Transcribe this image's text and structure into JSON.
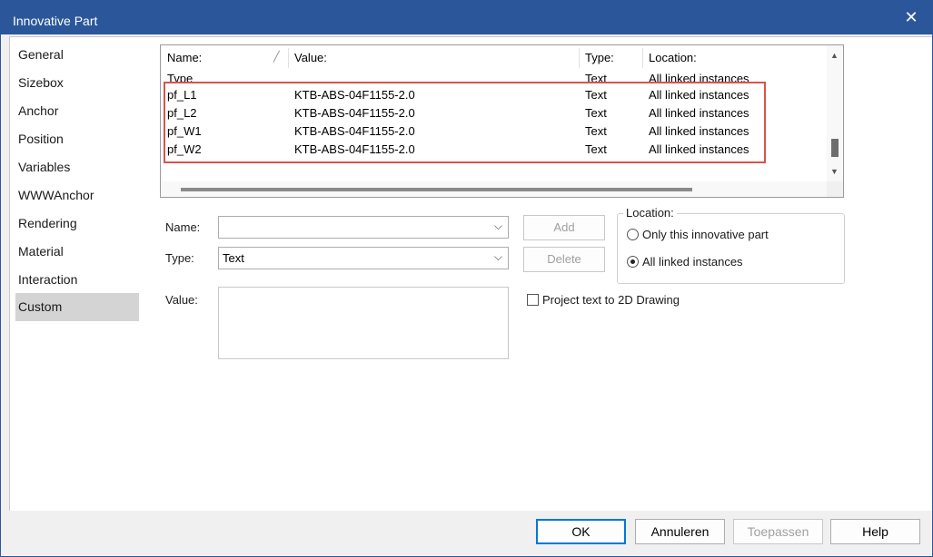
{
  "window": {
    "title": "Innovative Part"
  },
  "sidebar": {
    "items": [
      {
        "label": "General"
      },
      {
        "label": "Sizebox"
      },
      {
        "label": "Anchor"
      },
      {
        "label": "Position"
      },
      {
        "label": "Variables"
      },
      {
        "label": "WWWAnchor"
      },
      {
        "label": "Rendering"
      },
      {
        "label": "Material"
      },
      {
        "label": "Interaction"
      },
      {
        "label": "Custom",
        "selected": true
      }
    ]
  },
  "list": {
    "columns": [
      "Name:",
      "Value:",
      "Type:",
      "Location:"
    ],
    "rows": [
      {
        "name": "Type",
        "value": "",
        "type": "Text",
        "location": "All linked instances"
      },
      {
        "name": "pf_L1",
        "value": "KTB-ABS-04F1155-2.0",
        "type": "Text",
        "location": "All linked instances"
      },
      {
        "name": "pf_L2",
        "value": "KTB-ABS-04F1155-2.0",
        "type": "Text",
        "location": "All linked instances"
      },
      {
        "name": "pf_W1",
        "value": "KTB-ABS-04F1155-2.0",
        "type": "Text",
        "location": "All linked instances"
      },
      {
        "name": "pf_W2",
        "value": "KTB-ABS-04F1155-2.0",
        "type": "Text",
        "location": "All linked instances"
      }
    ]
  },
  "form": {
    "name_label": "Name:",
    "name_value": "",
    "type_label": "Type:",
    "type_value": "Text",
    "value_label": "Value:",
    "value_text": "",
    "add_label": "Add",
    "delete_label": "Delete",
    "location_label": "Location:",
    "location_options": [
      {
        "label": "Only this innovative part",
        "selected": false
      },
      {
        "label": "All linked instances",
        "selected": true
      }
    ],
    "project_label": "Project text to 2D Drawing",
    "project_checked": false
  },
  "footer": {
    "ok": "OK",
    "cancel": "Annuleren",
    "apply": "Toepassen",
    "help": "Help"
  },
  "colors": {
    "titlebar": "#2b579a",
    "highlight": "#d9534f",
    "selected_item": "#d4d4d4"
  }
}
